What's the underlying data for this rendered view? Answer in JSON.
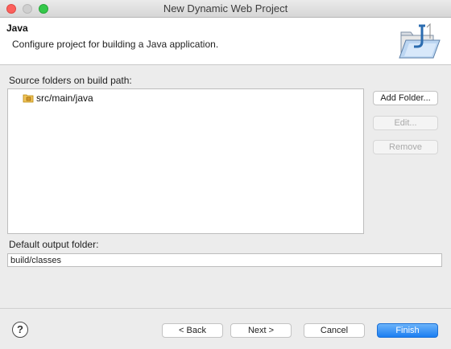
{
  "window": {
    "title": "New Dynamic Web Project"
  },
  "header": {
    "title": "Java",
    "description": "Configure project for building a Java application.",
    "graphic_icon": "java-folder-wizard-banner"
  },
  "source_folders": {
    "label": "Source folders on build path:",
    "items": [
      {
        "label": "src/main/java",
        "icon": "package-folder-icon"
      }
    ]
  },
  "side_buttons": {
    "add_folder": "Add Folder...",
    "edit": "Edit...",
    "remove": "Remove"
  },
  "output_folder": {
    "label": "Default output folder:",
    "value": "build/classes"
  },
  "footer": {
    "help": "?",
    "back": "< Back",
    "next": "Next >",
    "cancel": "Cancel",
    "finish": "Finish"
  },
  "colors": {
    "primary_button": "#1c7ef1",
    "close_dot": "#fc605c",
    "maximize_dot": "#34c84a"
  }
}
